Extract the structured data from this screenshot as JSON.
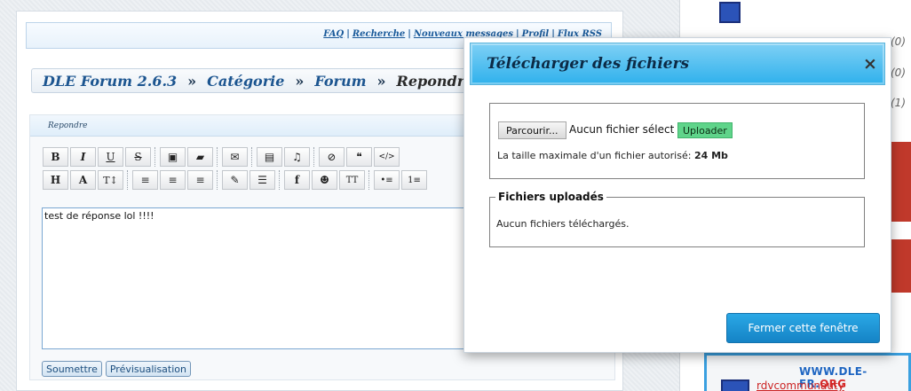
{
  "top_links": [
    "FAQ",
    "Recherche",
    "Nouveaux messages",
    "Profil",
    "Flux RSS"
  ],
  "breadcrumb": {
    "items": [
      "DLE Forum 2.6.3",
      "Catégorie",
      "Forum"
    ],
    "separator": "»",
    "current": "Repondre"
  },
  "reply": {
    "header": "Repondre",
    "editor_text": "test de réponse lol !!!!",
    "submit_label": "Soumettre",
    "preview_label": "Prévisualisation"
  },
  "toolbar": {
    "row1": [
      {
        "icon": "bold-icon",
        "glyph": "B"
      },
      {
        "icon": "italic-icon",
        "glyph": "I"
      },
      {
        "icon": "underline-icon",
        "glyph": "U"
      },
      {
        "icon": "strikethrough-icon",
        "glyph": "S"
      },
      {
        "icon": "image-icon",
        "glyph": "▣"
      },
      {
        "icon": "folder-icon",
        "glyph": "▰"
      },
      {
        "icon": "email-icon",
        "glyph": "✉"
      },
      {
        "icon": "video-icon",
        "glyph": "▤"
      },
      {
        "icon": "music-icon",
        "glyph": "♫"
      },
      {
        "icon": "hide-icon",
        "glyph": "⊘"
      },
      {
        "icon": "quote-icon",
        "glyph": "❝"
      },
      {
        "icon": "code-icon",
        "glyph": "</>"
      }
    ],
    "row2": [
      {
        "icon": "heading-icon",
        "glyph": "H"
      },
      {
        "icon": "font-icon",
        "glyph": "A"
      },
      {
        "icon": "text-size-icon",
        "glyph": "T↕"
      },
      {
        "icon": "align-left-icon",
        "glyph": "≡"
      },
      {
        "icon": "align-center-icon",
        "glyph": "≡"
      },
      {
        "icon": "align-right-icon",
        "glyph": "≡"
      },
      {
        "icon": "pen-icon",
        "glyph": "✎"
      },
      {
        "icon": "paragraph-icon",
        "glyph": "☰"
      },
      {
        "icon": "facebook-icon",
        "glyph": "f"
      },
      {
        "icon": "emoticon-icon",
        "glyph": "☻"
      },
      {
        "icon": "typography-icon",
        "glyph": "TT"
      },
      {
        "icon": "bullet-list-icon",
        "glyph": "•≡"
      },
      {
        "icon": "numbered-list-icon",
        "glyph": "1≡"
      }
    ]
  },
  "sidebar": {
    "counts": [
      "(0)",
      "(0)",
      "(1)"
    ],
    "watermark": "WWW.DLE-FR.",
    "watermark_suffix": "ORG",
    "user_link": "rdvcommunauty"
  },
  "modal": {
    "title": "Télécharger des fichiers",
    "close_glyph": "×",
    "browse_label": "Parcourir...",
    "file_status": "Aucun fichier sélectionné",
    "upload_label": "Uploader",
    "max_size_text": "La taille maximale d'un fichier autorisé:",
    "max_size_value": "24 Mb",
    "uploaded_legend": "Fichiers uploadés",
    "no_files_text": "Aucun fichiers téléchargés.",
    "close_window_label": "Fermer cette fenêtre"
  },
  "colors": {
    "accent": "#2fb1ec",
    "upload_button": "#5fd48a",
    "link": "#1c5590"
  }
}
